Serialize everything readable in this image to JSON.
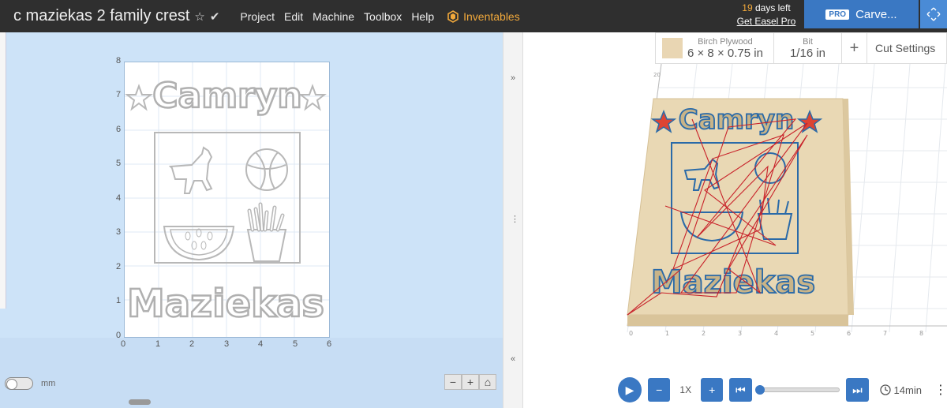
{
  "header": {
    "project_title": "c maziekas 2 family crest",
    "star_icon": "star-outline",
    "check_icon": "checkmark",
    "menu": [
      "Project",
      "Edit",
      "Machine",
      "Toolbox",
      "Help"
    ],
    "inventables_label": "Inventables",
    "trial_days": "19",
    "trial_days_suffix": "days left",
    "get_pro_link": "Get Easel Pro",
    "pro_badge": "PRO",
    "carve_button": "Carve...",
    "accent": "#3a78c3",
    "brand_orange": "#f2a93b"
  },
  "design": {
    "y_ticks": [
      "8",
      "7",
      "6",
      "5",
      "4",
      "3",
      "2",
      "1",
      "0"
    ],
    "x_ticks": [
      "0",
      "1",
      "2",
      "3",
      "4",
      "5",
      "6"
    ],
    "top_text": "Camryn",
    "bottom_text": "Maziekas",
    "units_label": "mm",
    "zoom_out": "−",
    "zoom_in": "+",
    "home_icon": "home"
  },
  "material": {
    "name": "Birch Plywood",
    "size": "6 × 8 × 0.75 in",
    "bit_label": "Bit",
    "bit_value": "1/16 in",
    "add_label": "+",
    "cut_settings": "Cut Settings",
    "swatch_color": "#e9d6b3"
  },
  "preview": {
    "y_axis_label": "20",
    "x_ticks": [
      "0",
      "1",
      "2",
      "3",
      "4",
      "5",
      "6",
      "7",
      "8"
    ],
    "top_text": "Camryn",
    "bottom_text": "Maziekas"
  },
  "player": {
    "speed": "1X",
    "time": "14min"
  }
}
